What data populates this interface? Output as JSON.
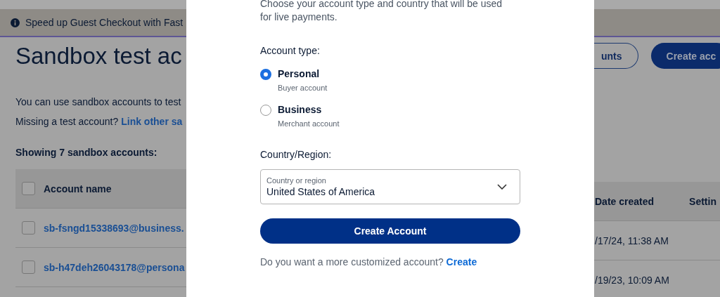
{
  "banner": {
    "text": "Speed up Guest Checkout with Fast"
  },
  "page": {
    "title": "Sandbox test ac",
    "intro": "You can use sandbox accounts to test",
    "missing": "Missing a test account?",
    "link": "Link other sa",
    "count": "Showing 7 sandbox accounts:"
  },
  "header_buttons": [
    {
      "label": "unts",
      "kind": "outline"
    },
    {
      "label": "Create acc",
      "kind": "filled"
    }
  ],
  "table": {
    "all_checked": false,
    "columns": [
      "Account name",
      "Date created",
      "Settin"
    ],
    "rows": [
      {
        "checked": false,
        "name": "sb-fsngd15338693@business.",
        "date": "/17/24, 11:38 AM"
      },
      {
        "checked": false,
        "name": "sb-h47deh26043178@persona",
        "date": "/19/23, 10:09 AM"
      }
    ]
  },
  "dialog": {
    "intro": "Choose your account type and country that will be used for live payments.",
    "type_label": "Account type:",
    "options": [
      {
        "title": "Personal",
        "subtitle": "Buyer account",
        "selected": true
      },
      {
        "title": "Business",
        "subtitle": "Merchant account",
        "selected": false
      }
    ],
    "country_label": "Country/Region:",
    "country_field": {
      "label": "Country or region",
      "value": "United States of America"
    },
    "submit": "Create Account",
    "footer": "Do you want a more customized account?",
    "footer_link": "Create"
  }
}
